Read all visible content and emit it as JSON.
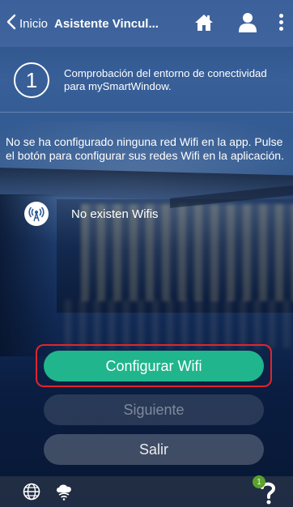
{
  "header": {
    "back_label": "Inicio",
    "title": "Asistente Vincul...",
    "icons": [
      "chevron-left-icon",
      "home-icon",
      "user-icon",
      "more-vertical-icon"
    ]
  },
  "step": {
    "number": "1",
    "text": "Comprobación del entorno de conectividad para mySmartWindow."
  },
  "info_text": "No se ha configurado ninguna red Wifi en la app. Pulse el botón para configurar sus redes Wifi en la aplicación.",
  "wifi": {
    "icon": "wifi-antenna-icon",
    "label": "No existen Wifis"
  },
  "buttons": {
    "configure": "Configurar Wifi",
    "next": "Siguiente",
    "exit": "Salir"
  },
  "bottom": {
    "icons": [
      "globe-icon",
      "cloud-wifi-icon",
      "help-icon"
    ],
    "badge_count": "1"
  },
  "colors": {
    "accent": "#20b58c",
    "highlight_border": "#e3242b",
    "badge": "#5aa12d"
  }
}
